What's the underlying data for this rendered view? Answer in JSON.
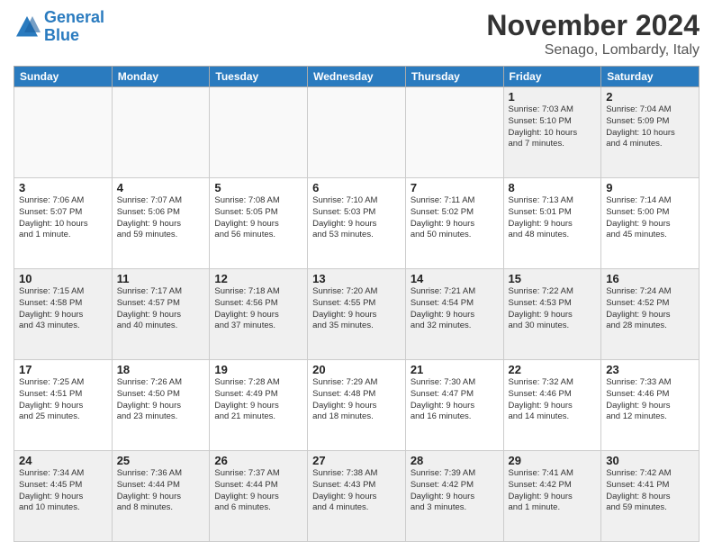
{
  "logo": {
    "text1": "General",
    "text2": "Blue"
  },
  "title": "November 2024",
  "location": "Senago, Lombardy, Italy",
  "weekdays": [
    "Sunday",
    "Monday",
    "Tuesday",
    "Wednesday",
    "Thursday",
    "Friday",
    "Saturday"
  ],
  "weeks": [
    [
      {
        "day": "",
        "info": ""
      },
      {
        "day": "",
        "info": ""
      },
      {
        "day": "",
        "info": ""
      },
      {
        "day": "",
        "info": ""
      },
      {
        "day": "",
        "info": ""
      },
      {
        "day": "1",
        "info": "Sunrise: 7:03 AM\nSunset: 5:10 PM\nDaylight: 10 hours\nand 7 minutes."
      },
      {
        "day": "2",
        "info": "Sunrise: 7:04 AM\nSunset: 5:09 PM\nDaylight: 10 hours\nand 4 minutes."
      }
    ],
    [
      {
        "day": "3",
        "info": "Sunrise: 7:06 AM\nSunset: 5:07 PM\nDaylight: 10 hours\nand 1 minute."
      },
      {
        "day": "4",
        "info": "Sunrise: 7:07 AM\nSunset: 5:06 PM\nDaylight: 9 hours\nand 59 minutes."
      },
      {
        "day": "5",
        "info": "Sunrise: 7:08 AM\nSunset: 5:05 PM\nDaylight: 9 hours\nand 56 minutes."
      },
      {
        "day": "6",
        "info": "Sunrise: 7:10 AM\nSunset: 5:03 PM\nDaylight: 9 hours\nand 53 minutes."
      },
      {
        "day": "7",
        "info": "Sunrise: 7:11 AM\nSunset: 5:02 PM\nDaylight: 9 hours\nand 50 minutes."
      },
      {
        "day": "8",
        "info": "Sunrise: 7:13 AM\nSunset: 5:01 PM\nDaylight: 9 hours\nand 48 minutes."
      },
      {
        "day": "9",
        "info": "Sunrise: 7:14 AM\nSunset: 5:00 PM\nDaylight: 9 hours\nand 45 minutes."
      }
    ],
    [
      {
        "day": "10",
        "info": "Sunrise: 7:15 AM\nSunset: 4:58 PM\nDaylight: 9 hours\nand 43 minutes."
      },
      {
        "day": "11",
        "info": "Sunrise: 7:17 AM\nSunset: 4:57 PM\nDaylight: 9 hours\nand 40 minutes."
      },
      {
        "day": "12",
        "info": "Sunrise: 7:18 AM\nSunset: 4:56 PM\nDaylight: 9 hours\nand 37 minutes."
      },
      {
        "day": "13",
        "info": "Sunrise: 7:20 AM\nSunset: 4:55 PM\nDaylight: 9 hours\nand 35 minutes."
      },
      {
        "day": "14",
        "info": "Sunrise: 7:21 AM\nSunset: 4:54 PM\nDaylight: 9 hours\nand 32 minutes."
      },
      {
        "day": "15",
        "info": "Sunrise: 7:22 AM\nSunset: 4:53 PM\nDaylight: 9 hours\nand 30 minutes."
      },
      {
        "day": "16",
        "info": "Sunrise: 7:24 AM\nSunset: 4:52 PM\nDaylight: 9 hours\nand 28 minutes."
      }
    ],
    [
      {
        "day": "17",
        "info": "Sunrise: 7:25 AM\nSunset: 4:51 PM\nDaylight: 9 hours\nand 25 minutes."
      },
      {
        "day": "18",
        "info": "Sunrise: 7:26 AM\nSunset: 4:50 PM\nDaylight: 9 hours\nand 23 minutes."
      },
      {
        "day": "19",
        "info": "Sunrise: 7:28 AM\nSunset: 4:49 PM\nDaylight: 9 hours\nand 21 minutes."
      },
      {
        "day": "20",
        "info": "Sunrise: 7:29 AM\nSunset: 4:48 PM\nDaylight: 9 hours\nand 18 minutes."
      },
      {
        "day": "21",
        "info": "Sunrise: 7:30 AM\nSunset: 4:47 PM\nDaylight: 9 hours\nand 16 minutes."
      },
      {
        "day": "22",
        "info": "Sunrise: 7:32 AM\nSunset: 4:46 PM\nDaylight: 9 hours\nand 14 minutes."
      },
      {
        "day": "23",
        "info": "Sunrise: 7:33 AM\nSunset: 4:46 PM\nDaylight: 9 hours\nand 12 minutes."
      }
    ],
    [
      {
        "day": "24",
        "info": "Sunrise: 7:34 AM\nSunset: 4:45 PM\nDaylight: 9 hours\nand 10 minutes."
      },
      {
        "day": "25",
        "info": "Sunrise: 7:36 AM\nSunset: 4:44 PM\nDaylight: 9 hours\nand 8 minutes."
      },
      {
        "day": "26",
        "info": "Sunrise: 7:37 AM\nSunset: 4:44 PM\nDaylight: 9 hours\nand 6 minutes."
      },
      {
        "day": "27",
        "info": "Sunrise: 7:38 AM\nSunset: 4:43 PM\nDaylight: 9 hours\nand 4 minutes."
      },
      {
        "day": "28",
        "info": "Sunrise: 7:39 AM\nSunset: 4:42 PM\nDaylight: 9 hours\nand 3 minutes."
      },
      {
        "day": "29",
        "info": "Sunrise: 7:41 AM\nSunset: 4:42 PM\nDaylight: 9 hours\nand 1 minute."
      },
      {
        "day": "30",
        "info": "Sunrise: 7:42 AM\nSunset: 4:41 PM\nDaylight: 8 hours\nand 59 minutes."
      }
    ]
  ]
}
